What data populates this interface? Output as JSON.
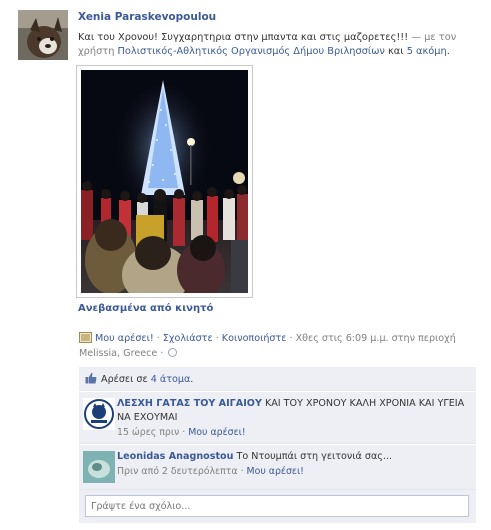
{
  "post": {
    "author": "Xenia Paraskevopoulou",
    "message": "Και του Χρονου! Συγχαρητηρια στην μπαντα και στις μαζορετες!!!",
    "tag_prefix": " — με τον χρήστη ",
    "tagged_user": "Πολιστικός-Αθλητικός Οργανισμός Δήμου Βριλησσίων",
    "tag_joiner": " και ",
    "tag_others": "5 ακόμη",
    "tag_end": ".",
    "uploaded_label": "Ανεβασμένα από κινητό"
  },
  "actions": {
    "like": "Μου αρέσει!",
    "comment": "Σχολιάστε",
    "share": "Κοινοποιήστε",
    "sep": " · ",
    "timestamp": "Χθες στις 6:09 μ.μ.",
    "location_prefix": " στην περιοχή ",
    "location": "Melissia, Greece",
    "globe_icon": "globe-icon"
  },
  "likes": {
    "prefix": "Αρέσει σε ",
    "count_label": "4 άτομα",
    "suffix": "."
  },
  "comments": [
    {
      "author": "ΛΕΣΧΗ ΓΑΤΑΣ ΤΟΥ ΑΙΓΑΙΟΥ",
      "text": " ΚΑΙ ΤΟΥ ΧΡΟΝΟΥ ΚΑΛΗ ΧΡΟΝΙΑ ΚΑΙ ΥΓΕΙΑ ΝΑ ΕΧΟΥΜΑΙ",
      "time": "15 ώρες πριν",
      "like": "Μου αρέσει!"
    },
    {
      "author": "Leonidas Anagnostou",
      "text": " Το Ντουμπάι στη γειτονιά σας...",
      "time": "Πριν από 2 δευτερόλεπτα",
      "like": "Μου αρέσει!"
    }
  ],
  "comment_input": {
    "placeholder": "Γράψτε ένα σχόλιο..."
  },
  "colors": {
    "link": "#3b5998",
    "feedback_bg": "#edeff4",
    "muted": "#808080"
  }
}
